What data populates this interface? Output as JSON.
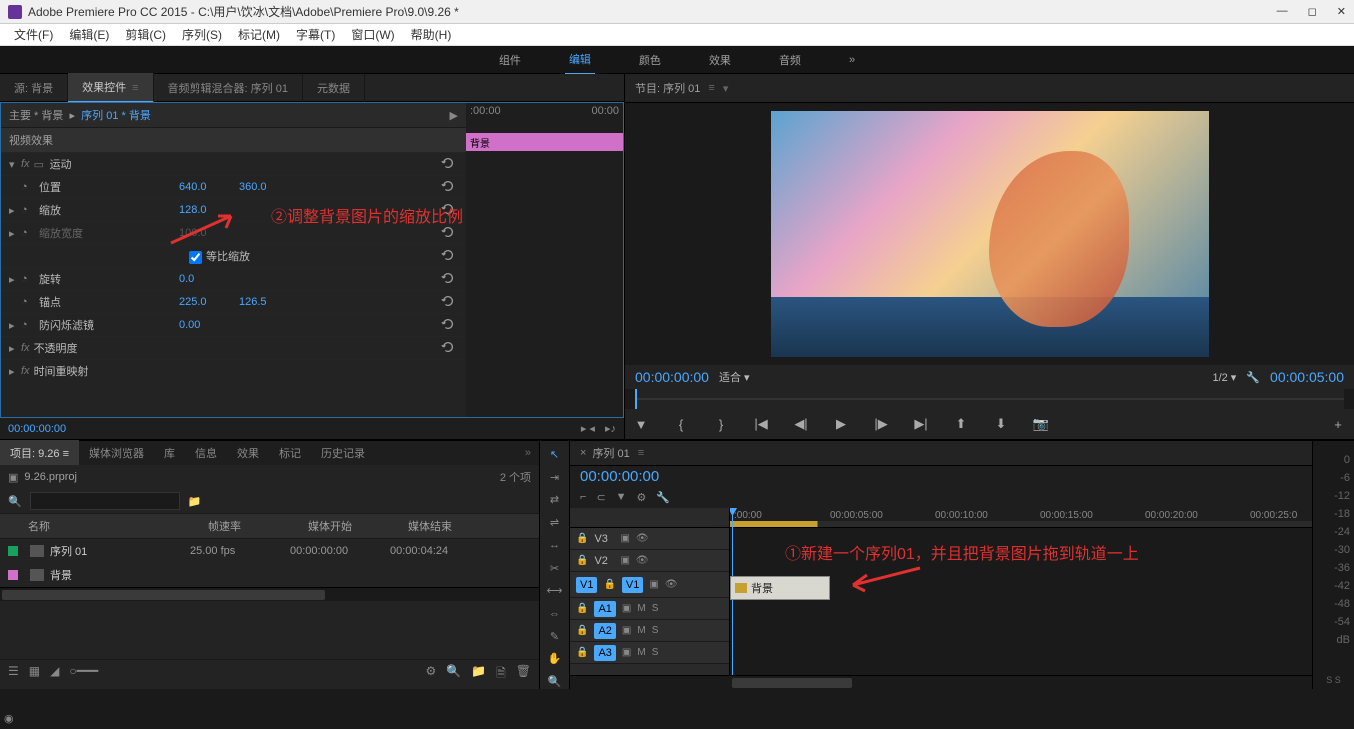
{
  "titlebar": {
    "app": "Adobe Premiere Pro CC 2015 - C:\\用户\\饮冰\\文档\\Adobe\\Premiere Pro\\9.0\\9.26 *"
  },
  "menu": [
    "文件(F)",
    "编辑(E)",
    "剪辑(C)",
    "序列(S)",
    "标记(M)",
    "字幕(T)",
    "窗口(W)",
    "帮助(H)"
  ],
  "workspace": {
    "tabs": [
      "组件",
      "编辑",
      "颜色",
      "效果",
      "音频"
    ],
    "active": "编辑"
  },
  "source_tabs": {
    "items": [
      "源: 背景",
      "效果控件",
      "音频剪辑混合器: 序列 01",
      "元数据"
    ],
    "active": "效果控件"
  },
  "effect_controls": {
    "breadcrumb_main": "主要 * 背景",
    "breadcrumb_seq": "序列 01 * 背景",
    "mini_tl": {
      "start": ":00:00",
      "end": "00:00"
    },
    "clip_label": "背景",
    "section_video": "视频效果",
    "motion": {
      "label": "运动",
      "position": {
        "label": "位置",
        "x": "640.0",
        "y": "360.0"
      },
      "scale": {
        "label": "缩放",
        "v": "128.0"
      },
      "scale_w": {
        "label": "缩放宽度",
        "v": "100.0"
      },
      "uniform": {
        "label": "等比缩放",
        "checked": true
      },
      "rotation": {
        "label": "旋转",
        "v": "0.0"
      },
      "anchor": {
        "label": "锚点",
        "x": "225.0",
        "y": "126.5"
      },
      "flicker": {
        "label": "防闪烁滤镜",
        "v": "0.00"
      }
    },
    "opacity": "不透明度",
    "time_remap": "时间重映射",
    "timecode": "00:00:00:00"
  },
  "annotations": {
    "a2": "②调整背景图片的缩放比例",
    "a1": "①新建一个序列01，并且把背景图片拖到轨道一上"
  },
  "program": {
    "title": "节目: 序列 01",
    "tc_left": "00:00:00:00",
    "fit": "适合",
    "ratio": "1/2",
    "tc_right": "00:00:05:00"
  },
  "project": {
    "tabs": [
      "项目: 9.26",
      "媒体浏览器",
      "库",
      "信息",
      "效果",
      "标记",
      "历史记录"
    ],
    "active": "项目: 9.26",
    "filename": "9.26.prproj",
    "count": "2 个项",
    "headers": {
      "name": "名称",
      "fps": "帧速率",
      "start": "媒体开始",
      "end": "媒体结束"
    },
    "items": [
      {
        "swatch": "#1aa05e",
        "name": "序列 01",
        "fps": "25.00 fps",
        "start": "00:00:00:00",
        "end": "00:00:04:24"
      },
      {
        "swatch": "#d070c8",
        "name": "背景",
        "fps": "",
        "start": "",
        "end": ""
      }
    ]
  },
  "timeline": {
    "title": "序列 01",
    "tc": "00:00:00:00",
    "ruler": [
      ":00:00",
      "00:00:05:00",
      "00:00:10:00",
      "00:00:15:00",
      "00:00:20:00",
      "00:00:25:0"
    ],
    "v_tracks": [
      "V3",
      "V2",
      "V1"
    ],
    "a_tracks": [
      "A1",
      "A2",
      "A3"
    ],
    "clip": "背景"
  },
  "meters": {
    "marks": [
      "0",
      "-6",
      "-12",
      "-18",
      "-24",
      "-30",
      "-36",
      "-42",
      "-48",
      "-54"
    ],
    "bottom": "S  S",
    "db": "dB"
  }
}
